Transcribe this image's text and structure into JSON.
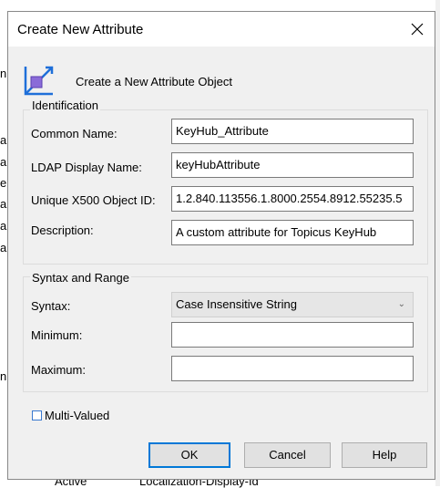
{
  "background": {
    "left_letters": [
      "n",
      "a",
      "a",
      "e",
      "a",
      "a",
      "a",
      "n"
    ],
    "bottom_texts": [
      "Active",
      "Localization-Display-Id"
    ]
  },
  "dialog": {
    "title": "Create New Attribute",
    "header_text": "Create a New Attribute Object",
    "icons": {
      "close": "close-icon",
      "header": "attribute-object-icon"
    },
    "identification": {
      "label": "Identification",
      "common_name_label": "Common Name:",
      "common_name_value": "KeyHub_Attribute",
      "ldap_label": "LDAP Display Name:",
      "ldap_value": "keyHubAttribute",
      "oid_label": "Unique X500 Object ID:",
      "oid_value": "1.2.840.113556.1.8000.2554.8912.55235.5",
      "description_label": "Description:",
      "description_value": "A custom attribute for Topicus KeyHub"
    },
    "syntax_range": {
      "label": "Syntax and Range",
      "syntax_label": "Syntax:",
      "syntax_value": "Case Insensitive String",
      "minimum_label": "Minimum:",
      "minimum_value": "",
      "maximum_label": "Maximum:",
      "maximum_value": ""
    },
    "multi_valued_label": "Multi-Valued",
    "multi_valued_checked": false,
    "buttons": {
      "ok": "OK",
      "cancel": "Cancel",
      "help": "Help"
    },
    "colors": {
      "accent": "#0078d7",
      "icon_blue": "#1e6fd9",
      "icon_purple": "#8a6bd8"
    }
  }
}
